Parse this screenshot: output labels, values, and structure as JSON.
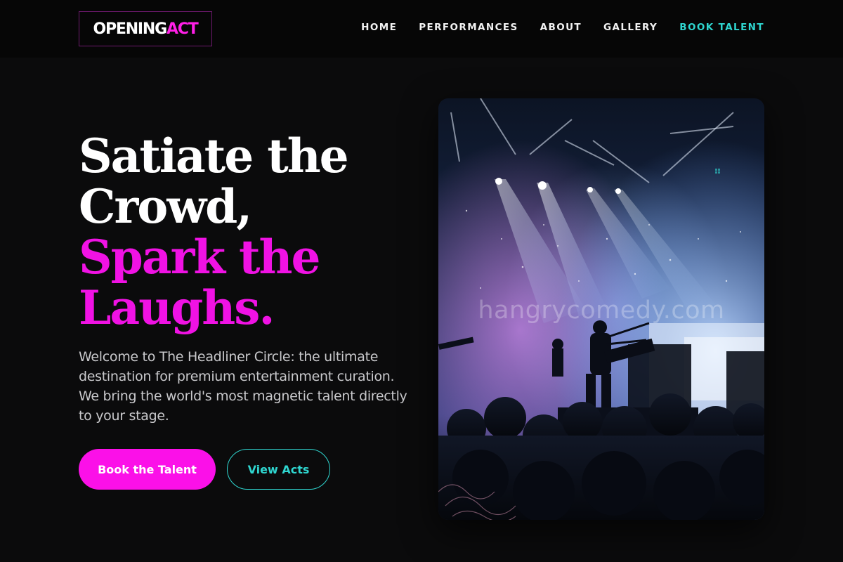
{
  "brand": {
    "logo_part1": "OPENING",
    "logo_part2": "ACT",
    "accent_color": "#ff1fe6",
    "secondary_color": "#2fd6d0"
  },
  "nav": {
    "items": [
      {
        "label": "HOME"
      },
      {
        "label": "PERFORMANCES"
      },
      {
        "label": "ABOUT"
      },
      {
        "label": "GALLERY"
      },
      {
        "label": "BOOK TALENT",
        "accent": true
      }
    ]
  },
  "hero": {
    "headline_line1": "Satiate the",
    "headline_line2": "Crowd,",
    "headline_line3": "Spark the",
    "headline_line4": "Laughs.",
    "description": "Welcome to The Headliner Circle: the ultimate destination for premium entertainment curation. We bring the world's most magnetic talent directly to your stage.",
    "primary_button": "Book the Talent",
    "secondary_button": "View Acts",
    "image": {
      "subject": "concert-stage-photo",
      "watermark": "hangrycomedy.com"
    }
  }
}
